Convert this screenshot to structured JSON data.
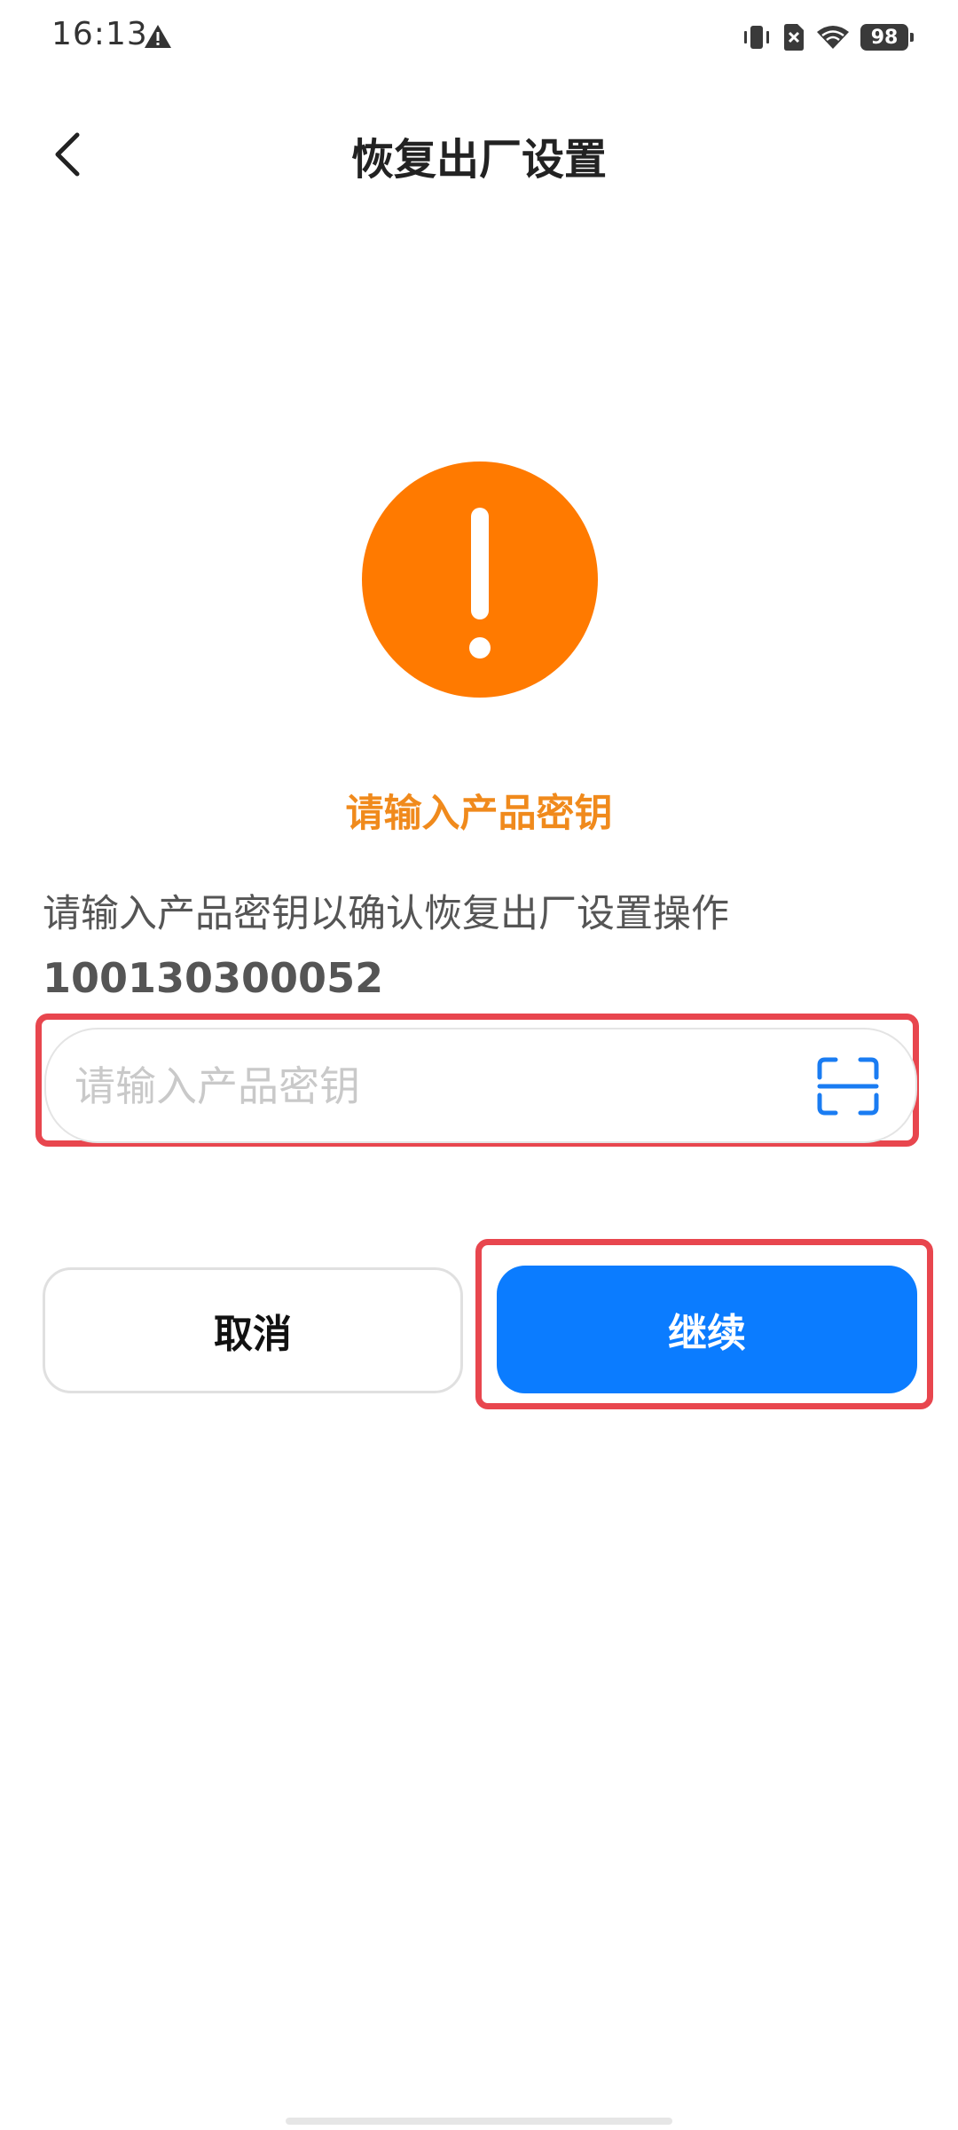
{
  "status_bar": {
    "time": "16:13",
    "battery": "98",
    "icons": [
      "alert-icon",
      "vibrate-icon",
      "no-sim-icon",
      "wifi-icon",
      "battery-icon"
    ]
  },
  "header": {
    "title": "恢复出厂设置",
    "back_icon": "chevron-left-icon"
  },
  "warning": {
    "icon": "exclamation-circle-icon",
    "color": "#ff7a00"
  },
  "prompt": {
    "heading": "请输入产品密钥",
    "heading_color": "#f08a1c",
    "instruction": "请输入产品密钥以确认恢复出厂设置操作",
    "product_id": "100130300052"
  },
  "key_input": {
    "value": "",
    "placeholder": "请输入产品密钥",
    "scan_icon": "scan-icon"
  },
  "actions": {
    "cancel_label": "取消",
    "continue_label": "继续",
    "accent_color": "#0b7cff"
  },
  "highlight_color": "#e8464e"
}
